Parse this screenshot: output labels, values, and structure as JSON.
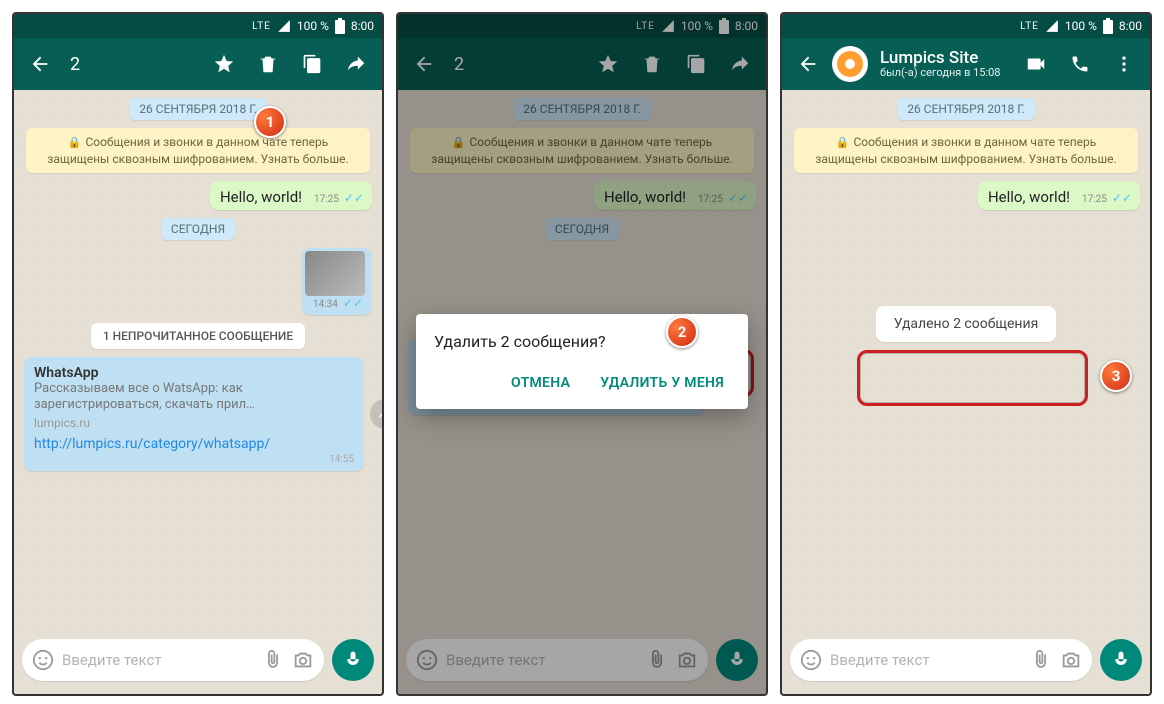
{
  "status": {
    "lte": "LTE",
    "signal_full": true,
    "battery": "100 %",
    "time": "8:00"
  },
  "select_bar": {
    "count": "2"
  },
  "chat_header": {
    "title": "Lumpics Site",
    "subtitle": "был(-а) сегодня в 15:08"
  },
  "chips": {
    "date": "26 СЕНТЯБРЯ 2018 Г.",
    "encryption": "Сообщения и звонки в данном чате теперь защищены сквозным шифрованием. Узнать больше.",
    "today": "СЕГОДНЯ",
    "unread": "1 НЕПРОЧИТАННОЕ СООБЩЕНИЕ",
    "deleted_toast": "Удалено 2 сообщения"
  },
  "msg_hello": {
    "text": "Hello, world!",
    "time": "17:25"
  },
  "msg_img": {
    "time": "14:34"
  },
  "msg_link": {
    "title": "WhatsApp",
    "desc": "Рассказываем все о WatsApp: как зарегистрироваться, скачать прил…",
    "desc_cut": "Рассказываем все о WatsApp: как зарегист...",
    "domain": "lumpics.ru",
    "url": "http://lumpics.ru/category/whatsapp/",
    "time": "14:55"
  },
  "dialog": {
    "title": "Удалить 2 сообщения?",
    "cancel": "ОТМЕНА",
    "delete": "УДАЛИТЬ У МЕНЯ"
  },
  "input": {
    "placeholder": "Введите текст"
  },
  "steps": {
    "s1": "1",
    "s2": "2",
    "s3": "3"
  }
}
